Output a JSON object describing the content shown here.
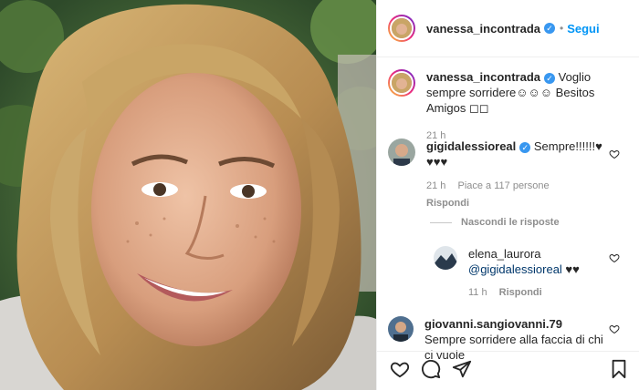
{
  "post_owner": {
    "username": "vanessa_incontrada",
    "follow_label": "Segui",
    "separator": "•"
  },
  "caption": {
    "username": "vanessa_incontrada",
    "text": "Voglio sempre sorridere☺☺☺ Besitos Amigos ◻◻",
    "time": "21 h"
  },
  "comments": [
    {
      "username": "gigidalessioreal",
      "text": "Sempre!!!!!!♥ ♥♥♥",
      "time": "21 h",
      "likes": "Piace a 117 persone",
      "reply_label": "Rispondi"
    }
  ],
  "hide_replies_label": "Nascondi le risposte",
  "reply": {
    "username": "elena_laurora",
    "mention": "@gigidalessioreal",
    "text": " ♥♥",
    "time": "11 h",
    "reply_label": "Rispondi"
  },
  "comment2": {
    "username": "giovanni.sangiovanni.79",
    "text": "Sempre sorridere alla faccia di chi ci vuole"
  },
  "icons": {
    "like": "heart-icon",
    "comment": "comment-icon",
    "share": "share-icon",
    "save": "bookmark-icon",
    "verified": "verified-badge-icon"
  },
  "colors": {
    "follow_blue": "#0095f6",
    "verified_blue": "#3897f0",
    "meta_gray": "#8e8e8e"
  }
}
